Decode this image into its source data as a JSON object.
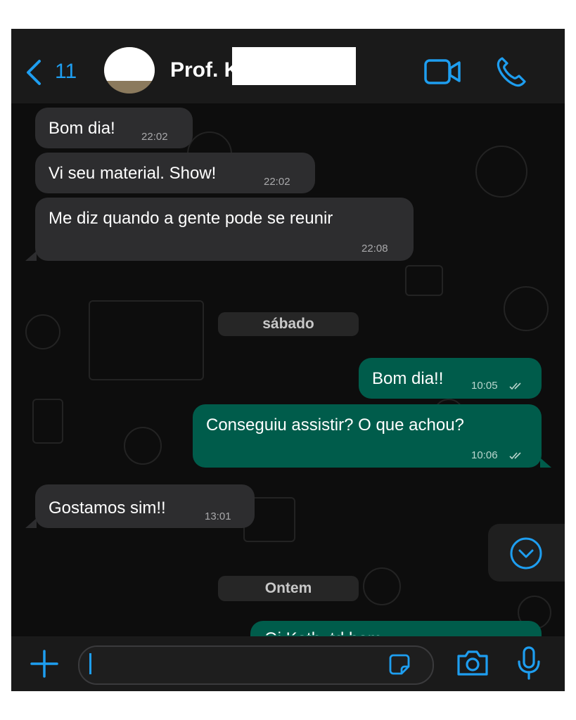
{
  "header": {
    "back_count": "11",
    "contact_name": "Prof. K",
    "icons": [
      "back-chevron-icon",
      "video-call-icon",
      "voice-call-icon"
    ]
  },
  "messages": [
    {
      "text": "Bom dia!",
      "time": "22:02",
      "direction": "incoming"
    },
    {
      "text": "Vi seu material. Show!",
      "time": "22:02",
      "direction": "incoming"
    },
    {
      "text": "Me diz quando a gente pode se reunir",
      "time": "22:08",
      "direction": "incoming"
    },
    {
      "text": "Bom dia!!",
      "time": "10:05",
      "direction": "outgoing",
      "status": "read"
    },
    {
      "text": "Conseguiu assistir? O que achou?",
      "time": "10:06",
      "direction": "outgoing",
      "status": "read"
    },
    {
      "text": "Gostamos sim!!",
      "time": "13:01",
      "direction": "incoming"
    },
    {
      "text": "Oi Kath, td bem...",
      "time": "",
      "direction": "outgoing",
      "partial": true
    }
  ],
  "date_separators": [
    "sábado",
    "Ontem"
  ],
  "composer": {
    "input_value": "",
    "icons": [
      "plus-icon",
      "sticker-icon",
      "camera-icon",
      "microphone-icon"
    ]
  },
  "colors": {
    "accent": "#1e9ef0",
    "incoming_bubble": "#2d2d2f",
    "outgoing_bubble": "#005c4b",
    "chat_background": "#0d0d0d",
    "bar_background": "#1a1a1a"
  }
}
